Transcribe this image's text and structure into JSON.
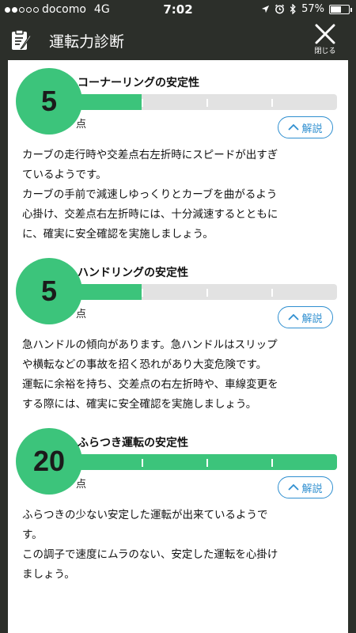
{
  "status_bar": {
    "carrier": "docomo",
    "network": "4G",
    "time": "7:02",
    "battery": "57%",
    "battery_level": 0.57,
    "signal_bars": 2
  },
  "header": {
    "title": "運転力診断",
    "close_label": "閉じる"
  },
  "colors": {
    "header_bg": "#2c2f2a",
    "accent_green": "#3cc47b",
    "link_blue": "#2f8fd0",
    "bar_bg": "#e2e2e2"
  },
  "sections": [
    {
      "score": "5",
      "unit": "点",
      "title": "コーナーリングの安定性",
      "fill_fraction": 0.25,
      "toggle_label": "解説",
      "description": [
        "カーブの走行時や交差点右左折時にスピードが出すぎ",
        "ているようです。",
        "カーブの手前で減速しゆっくりとカーブを曲がるよう",
        "心掛け、交差点右左折時には、十分減速するとともに",
        "に、確実に安全確認を実施しましょう。"
      ]
    },
    {
      "score": "5",
      "unit": "点",
      "title": "ハンドリングの安定性",
      "fill_fraction": 0.25,
      "toggle_label": "解説",
      "description": [
        "急ハンドルの傾向があります。急ハンドルはスリップ",
        "や横転などの事故を招く恐れがあり大変危険です。",
        "運転に余裕を持ち、交差点の右左折時や、車線変更を",
        "する際には、確実に安全確認を実施しましょう。"
      ]
    },
    {
      "score": "20",
      "unit": "点",
      "title": "ふらつき運転の安定性",
      "fill_fraction": 1.0,
      "toggle_label": "解説",
      "description": [
        "ふらつきの少ない安定した運転が出来ているようで",
        "す。",
        "この調子で速度にムラのない、安定した運転を心掛け",
        "ましょう。"
      ]
    }
  ]
}
